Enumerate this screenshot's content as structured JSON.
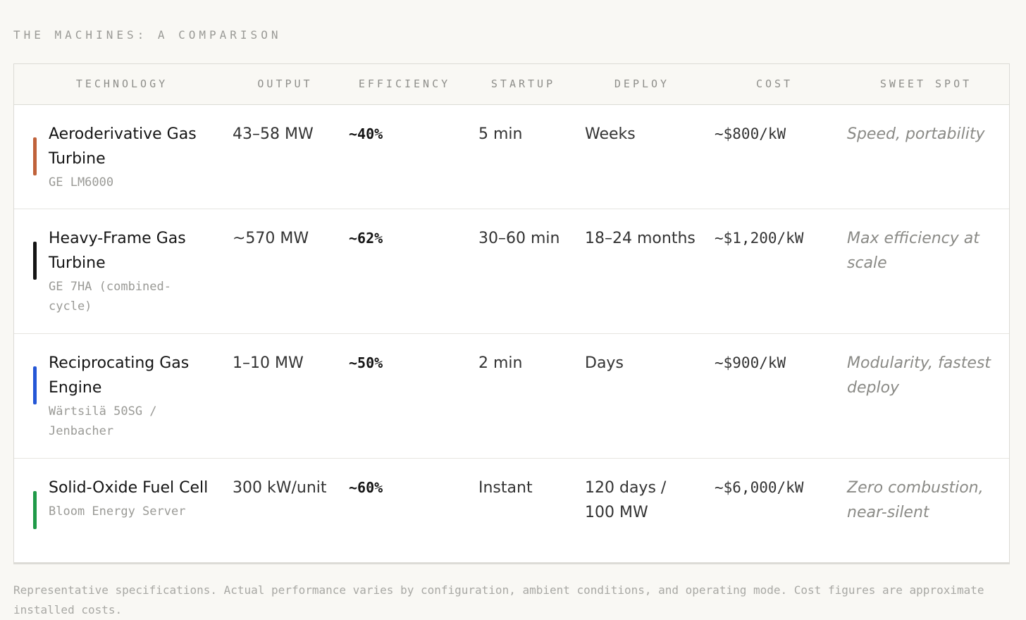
{
  "title": "THE MACHINES: A COMPARISON",
  "columns": [
    "TECHNOLOGY",
    "OUTPUT",
    "EFFICIENCY",
    "STARTUP",
    "DEPLOY",
    "COST",
    "SWEET SPOT"
  ],
  "rows": [
    {
      "name": "Aeroderivative Gas Turbine",
      "model": "GE LM6000",
      "color": "#c0623a",
      "output": "43–58 MW",
      "efficiency": "~40%",
      "startup": "5 min",
      "deploy": "Weeks",
      "cost": "~$800/kW",
      "sweet_spot": "Speed, portability"
    },
    {
      "name": "Heavy-Frame Gas Turbine",
      "model": "GE 7HA (combined-cycle)",
      "color": "#141414",
      "output": "~570 MW",
      "efficiency": "~62%",
      "startup": "30–60 min",
      "deploy": "18–24 months",
      "cost": "~$1,200/kW",
      "sweet_spot": "Max efficiency at scale"
    },
    {
      "name": "Reciprocating Gas Engine",
      "model": "Wärtsilä 50SG / Jenbacher",
      "color": "#2456d6",
      "output": "1–10 MW",
      "efficiency": "~50%",
      "startup": "2 min",
      "deploy": "Days",
      "cost": "~$900/kW",
      "sweet_spot": "Modularity, fastest deploy"
    },
    {
      "name": "Solid-Oxide Fuel Cell",
      "model": "Bloom Energy Server",
      "color": "#1f9a48",
      "output": "300 kW/unit",
      "efficiency": "~60%",
      "startup": "Instant",
      "deploy": "120 days / 100 MW",
      "cost": "~$6,000/kW",
      "sweet_spot": "Zero combustion, near-silent"
    }
  ],
  "footnote": "Representative specifications. Actual performance varies by configuration, ambient conditions, and operating mode. Cost figures are approximate installed costs."
}
